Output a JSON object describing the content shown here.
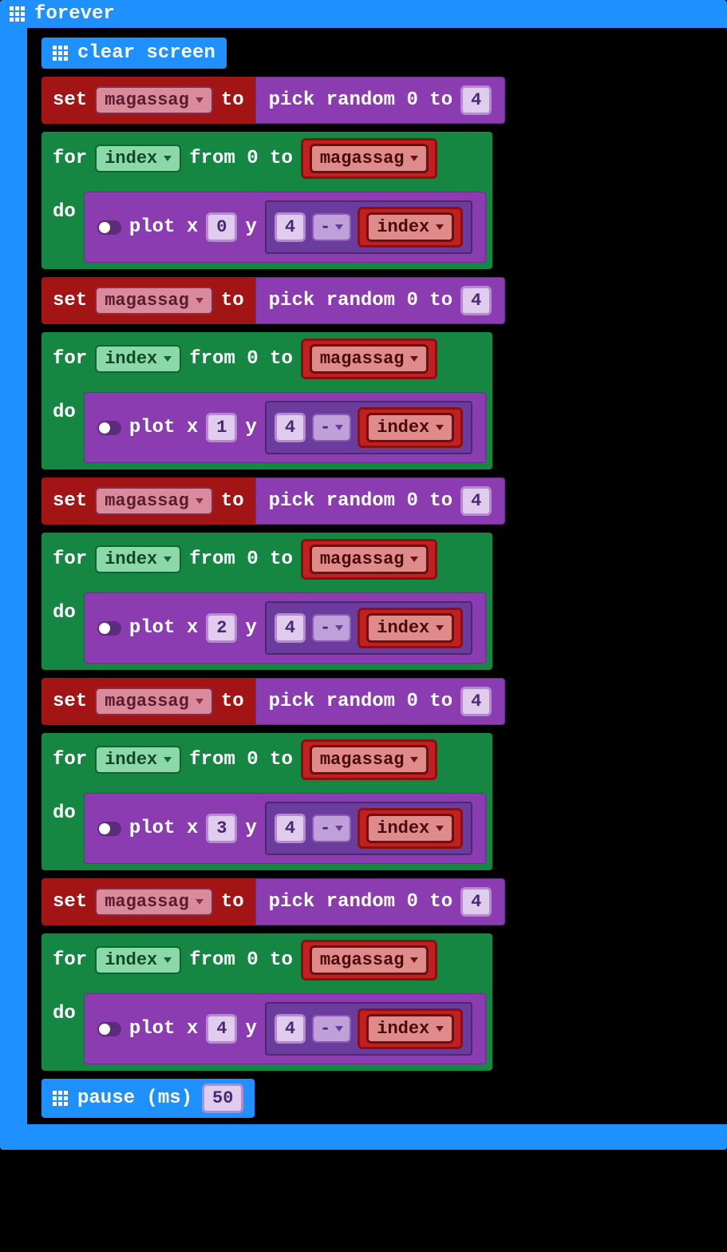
{
  "forever": {
    "label": "forever"
  },
  "clear_screen": {
    "label": "clear screen"
  },
  "set_label": "set",
  "to_label": "to",
  "for_label": "for",
  "from_label": "from 0 to",
  "do_label": "do",
  "plot_x": "plot x",
  "plot_y": "y",
  "pick_random": "pick random 0 to",
  "pause_label": "pause (ms)",
  "pause_value": "50",
  "minus": "-",
  "iterations": [
    {
      "var": "magassag",
      "random_max": "4",
      "loop_var": "index",
      "loop_limit_var": "magassag",
      "plot_x_val": "0",
      "y_left": "4",
      "y_op": "-",
      "y_right_var": "index"
    },
    {
      "var": "magassag",
      "random_max": "4",
      "loop_var": "index",
      "loop_limit_var": "magassag",
      "plot_x_val": "1",
      "y_left": "4",
      "y_op": "-",
      "y_right_var": "index"
    },
    {
      "var": "magassag",
      "random_max": "4",
      "loop_var": "index",
      "loop_limit_var": "magassag",
      "plot_x_val": "2",
      "y_left": "4",
      "y_op": "-",
      "y_right_var": "index"
    },
    {
      "var": "magassag",
      "random_max": "4",
      "loop_var": "index",
      "loop_limit_var": "magassag",
      "plot_x_val": "3",
      "y_left": "4",
      "y_op": "-",
      "y_right_var": "index"
    },
    {
      "var": "magassag",
      "random_max": "4",
      "loop_var": "index",
      "loop_limit_var": "magassag",
      "plot_x_val": "4",
      "y_left": "4",
      "y_op": "-",
      "y_right_var": "index"
    }
  ]
}
